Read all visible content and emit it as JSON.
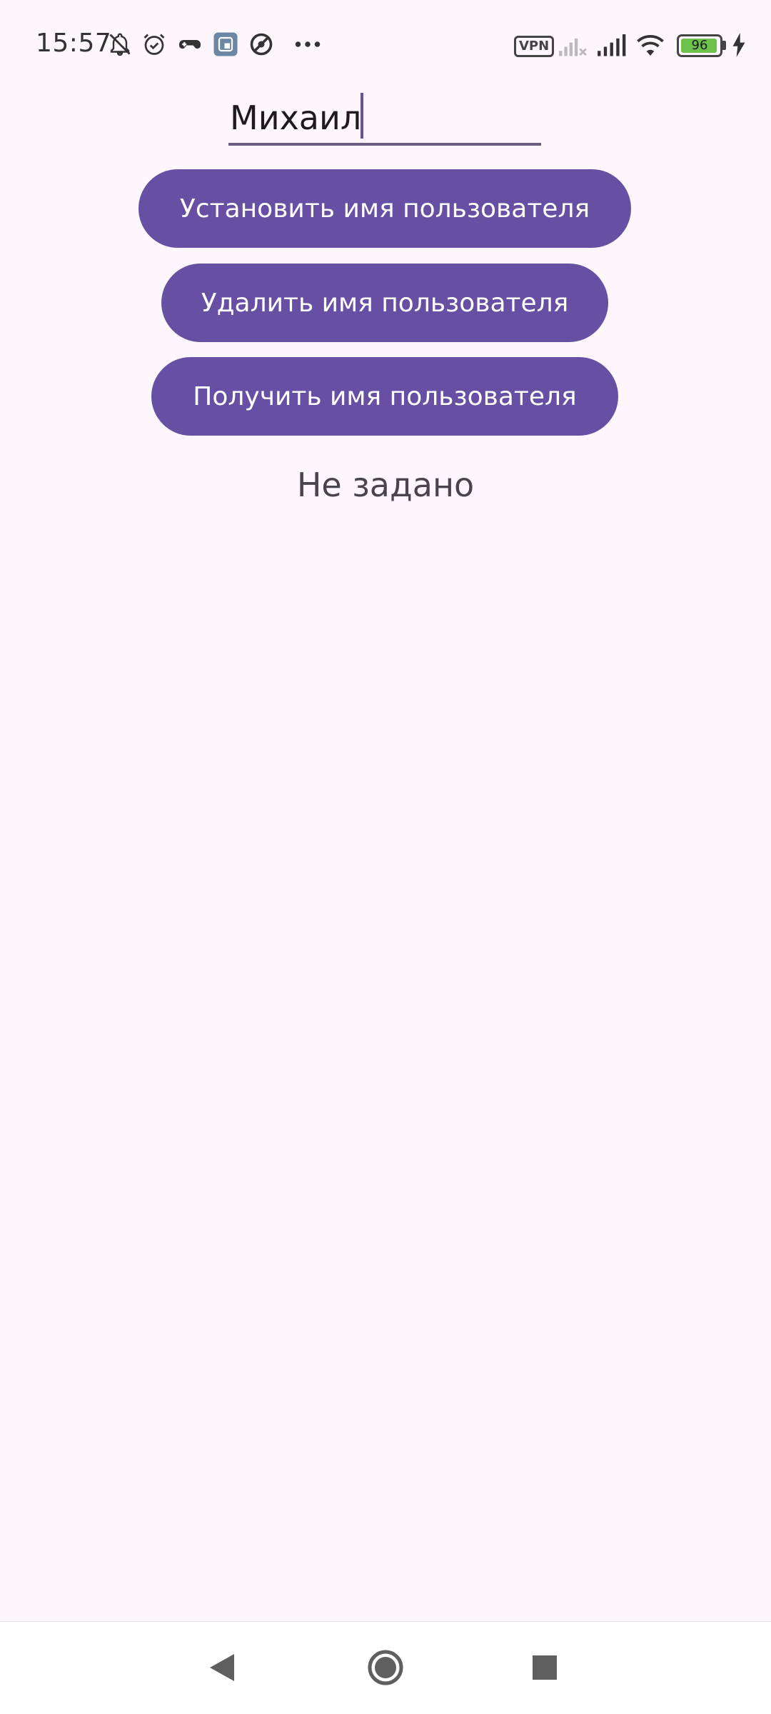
{
  "status_bar": {
    "time": "15:57",
    "left_icons": [
      "bell-off-icon",
      "alarm-icon",
      "gamepad-icon",
      "app-notification-icon",
      "location-off-icon",
      "more-dots-icon"
    ],
    "vpn_label": "VPN",
    "battery_level": "96",
    "battery_fraction": 0.96,
    "charging": true
  },
  "form": {
    "name_value": "Михаил"
  },
  "buttons": {
    "set_label": "Установить имя пользователя",
    "delete_label": "Удалить имя пользователя",
    "get_label": "Получить имя пользователя"
  },
  "result": {
    "text": "Не задано"
  },
  "colors": {
    "primary": "#6750a4",
    "background": "#fdf7fd",
    "on_primary": "#ffffff"
  },
  "nav_bar": {
    "buttons": [
      "back-icon",
      "home-icon",
      "recents-icon"
    ]
  }
}
